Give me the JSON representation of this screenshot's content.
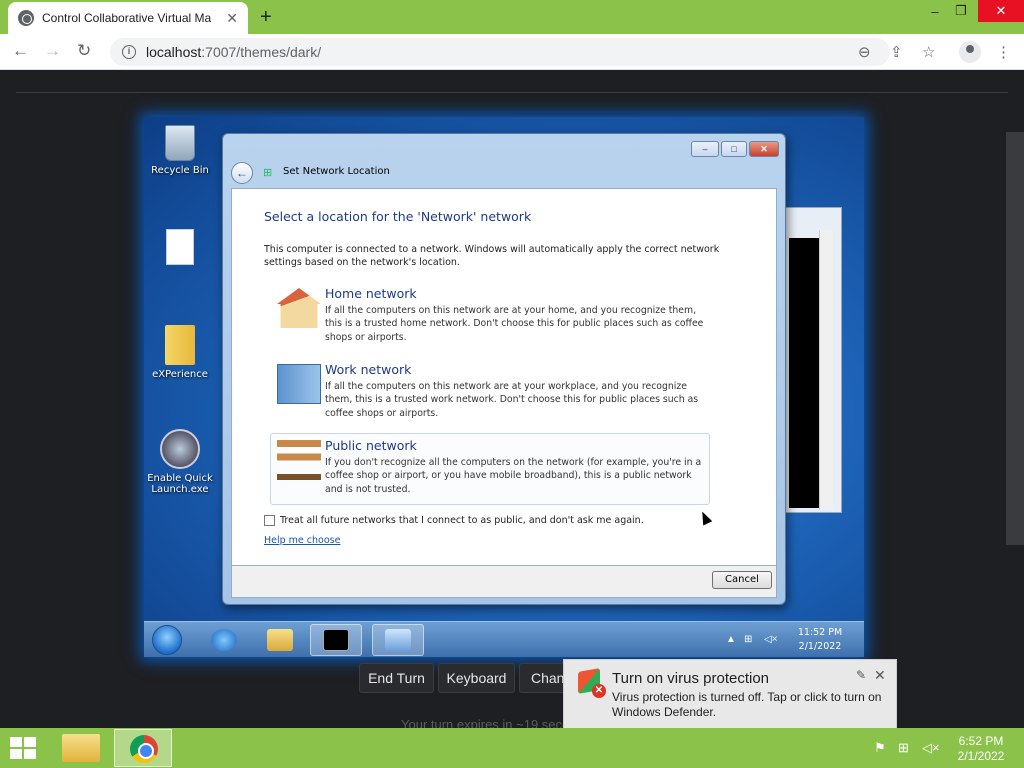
{
  "browser": {
    "tab_title": "Control Collaborative Virtual Ma",
    "tab_close": "✕",
    "new_tab": "+",
    "window_controls": {
      "minimize": "–",
      "restore": "❐",
      "close": "✕"
    },
    "url_host": "localhost",
    "url_rest": ":7007/themes/dark/",
    "nav": {
      "back": "←",
      "forward": "→",
      "reload": "↻"
    },
    "icons": {
      "zoom": "⊖",
      "share": "⇪",
      "star": "☆",
      "menu": "⋮"
    }
  },
  "vm": {
    "desktop_icons": [
      {
        "label": "Recycle Bin"
      },
      {
        "label": ""
      },
      {
        "label": "eXPerience"
      },
      {
        "label": "Enable Quick Launch.exe"
      }
    ],
    "dialog": {
      "title": "Set Network Location",
      "heading": "Select a location for the 'Network' network",
      "intro": "This computer is connected to a network. Windows will automatically apply the correct network settings based on the network's location.",
      "options": [
        {
          "name": "Home network",
          "desc": "If all the computers on this network are at your home, and you recognize them, this is a trusted home network.  Don't choose this for public places such as coffee shops or airports."
        },
        {
          "name": "Work network",
          "desc": "If all the computers on this network are at your workplace, and you recognize them, this is a trusted work network.  Don't choose this for public places such as coffee shops or airports."
        },
        {
          "name": "Public network",
          "desc": "If you don't recognize all the computers on the network (for example, you're in a coffee shop or airport, or you have mobile broadband), this is a public network and is not trusted."
        }
      ],
      "checkbox_label": "Treat all future networks that I connect to as public, and don't ask me again.",
      "help_link": "Help me choose",
      "cancel": "Cancel"
    },
    "clock_time": "11:52 PM",
    "clock_date": "2/1/2022"
  },
  "controls": {
    "end_turn": "End Turn",
    "keyboard": "Keyboard",
    "change": "Change",
    "turn_text": "Your turn expires in ~19 seconds"
  },
  "toast": {
    "title": "Turn on virus protection",
    "message": "Virus protection is turned off. Tap or click to turn on Windows Defender."
  },
  "host_taskbar": {
    "clock_time": "6:52 PM",
    "clock_date": "2/1/2022"
  }
}
